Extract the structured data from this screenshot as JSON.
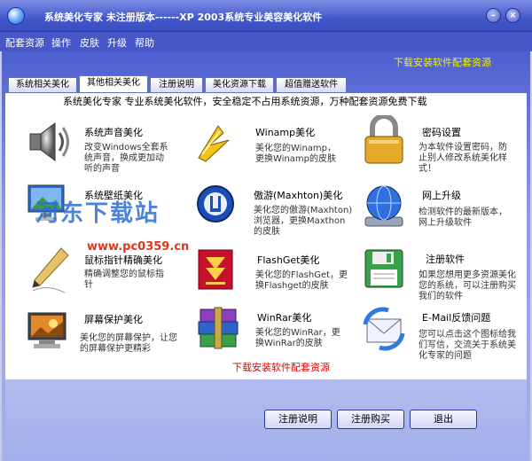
{
  "window": {
    "title": "系统美化专家   未注册版本------XP   2003系统专业美容美化软件",
    "min_label": "–",
    "close_label": "×"
  },
  "menu": [
    {
      "label": "配套资源"
    },
    {
      "label": "操作"
    },
    {
      "label": "皮肤"
    },
    {
      "label": "升级"
    },
    {
      "label": "帮助"
    }
  ],
  "top_link": "下载安装软件配套资源",
  "tabs": [
    {
      "label": "系统相关美化"
    },
    {
      "label": "其他相关美化"
    },
    {
      "label": "注册说明"
    },
    {
      "label": "美化资源下载"
    },
    {
      "label": "超值赠送软件"
    }
  ],
  "banner": "系统美化专家   专业系统美化软件，安全稳定不占用系统资源，万种配套资源免费下载",
  "features": [
    {
      "title": "系统声音美化",
      "desc": "改变Windows全套系统声音，换成更加动听的声音",
      "icon": "speaker-icon"
    },
    {
      "title": "系统壁纸美化",
      "desc": "",
      "icon": "wallpaper-icon"
    },
    {
      "title": "鼠标指针精确美化",
      "desc": "精确调整您的鼠标指针",
      "icon": "pen-cursor-icon"
    },
    {
      "title": "屏幕保护美化",
      "desc": "美化您的屏幕保护，让您的屏幕保护更精彩",
      "icon": "screensaver-icon"
    },
    {
      "title": "Winamp美化",
      "desc": "美化您的Winamp，更换Winamp的皮肤",
      "icon": "winamp-icon"
    },
    {
      "title": "傲游(Maxhton)美化",
      "desc": "美化您的傲游(Maxhton)浏览器，更换Maxthon的皮肤",
      "icon": "maxthon-icon"
    },
    {
      "title": "FlashGet美化",
      "desc": "美化您的FlashGet，更换Flashget的皮肤",
      "icon": "flashget-icon"
    },
    {
      "title": "WinRar美化",
      "desc": "美化您的WinRar，更换WinRar的皮肤",
      "icon": "winrar-icon"
    },
    {
      "title": "密码设置",
      "desc": "为本软件设置密码，防止别人修改系统美化样式！",
      "icon": "padlock-icon"
    },
    {
      "title": "网上升级",
      "desc": "检测软件的最新版本，网上升级软件",
      "icon": "globe-upgrade-icon"
    },
    {
      "title": "注册软件",
      "desc": "如果您想用更多资源美化您的系统，可以注册购买我们的软件",
      "icon": "floppy-register-icon"
    },
    {
      "title": "E-Mail反馈问题",
      "desc": "您可以点击这个图标给我们写信，交流关于系统美化专家的问题",
      "icon": "email-feedback-icon"
    }
  ],
  "bottom_link": "下载安装软件配套资源",
  "buttons": {
    "register_info": "注册说明",
    "register_buy": "注册购买",
    "exit": "退出"
  },
  "watermark": {
    "text": "河东下载站",
    "url": "www.pc0359.cn"
  }
}
